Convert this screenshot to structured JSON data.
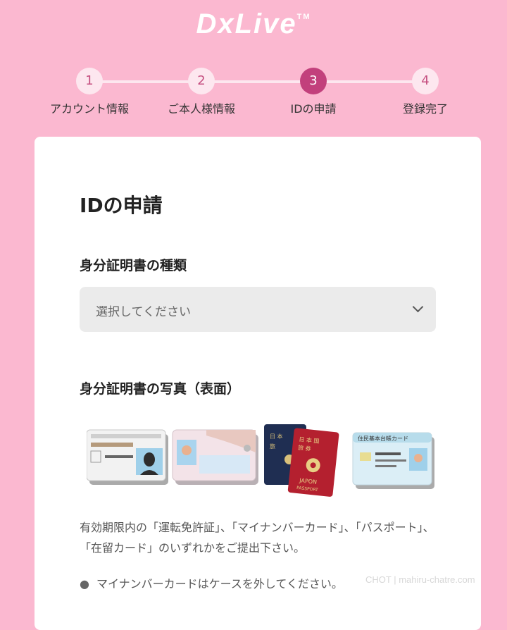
{
  "header": {
    "logo_text": "DxLive",
    "logo_mark": "TM"
  },
  "stepper": {
    "steps": [
      {
        "number": "1",
        "label": "アカウント情報"
      },
      {
        "number": "2",
        "label": "ご本人様情報"
      },
      {
        "number": "3",
        "label": "IDの申請"
      },
      {
        "number": "4",
        "label": "登録完了"
      }
    ],
    "active_step": 3
  },
  "form": {
    "title": "IDの申請",
    "id_type": {
      "label": "身分証明書の種類",
      "placeholder": "選択してください"
    },
    "id_photo": {
      "label": "身分証明書の写真（表面）",
      "card_texts": {
        "passport_country": "日本国旅券",
        "passport_front_a": "日 本 国",
        "passport_front_b": "旅 券",
        "passport_word1": "JAPON",
        "passport_word2": "PASSPORT",
        "resident_card": "住民基本台帳カード"
      },
      "description": "有効期限内の「運転免許証」、「マイナンバーカード」、「パスポート」、「在留カード」のいずれかをご提出下さい。",
      "note": "マイナンバーカードはケースを外してください。"
    }
  },
  "watermark": "CHOT | mahiru-chatre.com",
  "colors": {
    "background": "#fbb8d0",
    "accent": "#c2407c",
    "step_inactive": "#fde7ef",
    "select_bg": "#ebebeb"
  }
}
